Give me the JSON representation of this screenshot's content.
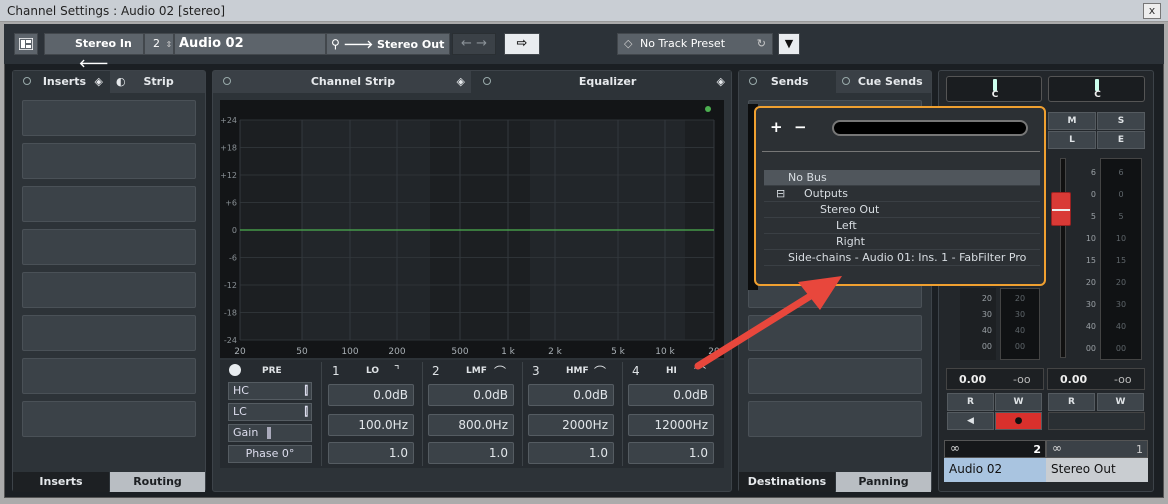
{
  "window": {
    "title": "Channel Settings : Audio 02 [stereo]",
    "close_label": "x"
  },
  "toolbar": {
    "input_route": "Stereo In",
    "channel_number": "2",
    "channel_name": "Audio 02",
    "output_route": "Stereo Out",
    "track_preset": "No Track Preset"
  },
  "left_panel": {
    "tab_inserts": "Inserts",
    "tab_strip": "Strip",
    "bottom_inserts": "Inserts",
    "bottom_routing": "Routing"
  },
  "middle_panel": {
    "tab_channel_strip": "Channel Strip",
    "tab_equalizer": "Equalizer"
  },
  "eq": {
    "y_labels": [
      "+24",
      "+18",
      "+12",
      "+6",
      "0",
      "-6",
      "-12",
      "-18",
      "-24"
    ],
    "x_labels": [
      "20",
      "50",
      "100",
      "200",
      "500",
      "1 k",
      "2 k",
      "5 k",
      "10 k",
      "20"
    ],
    "pre_label": "PRE",
    "hc_label": "HC",
    "lc_label": "LC",
    "gain_label": "Gain",
    "phase_label": "Phase 0°",
    "bands": [
      {
        "num": "1",
        "label": "LO",
        "gain": "0.0dB",
        "freq": "100.0Hz",
        "q": "1.0"
      },
      {
        "num": "2",
        "label": "LMF",
        "gain": "0.0dB",
        "freq": "800.0Hz",
        "q": "1.0"
      },
      {
        "num": "3",
        "label": "HMF",
        "gain": "0.0dB",
        "freq": "2000Hz",
        "q": "1.0"
      },
      {
        "num": "4",
        "label": "HI",
        "gain": "0.0dB",
        "freq": "12000Hz",
        "q": "1.0"
      }
    ]
  },
  "sends_panel": {
    "tab_sends": "Sends",
    "tab_cue_sends": "Cue Sends",
    "bottom_destinations": "Destinations",
    "bottom_panning": "Panning"
  },
  "popup": {
    "plus": "+",
    "minus": "−",
    "items": [
      {
        "label": "No Bus",
        "indent": 0,
        "selected": true
      },
      {
        "label": "Outputs",
        "indent": 1,
        "expander": "⊟"
      },
      {
        "label": "Stereo Out",
        "indent": 2
      },
      {
        "label": "Left",
        "indent": 3
      },
      {
        "label": "Right",
        "indent": 3
      },
      {
        "label": "Side-chains - Audio 01: Ins. 1 - FabFilter Pro",
        "indent": 0
      }
    ]
  },
  "fader": {
    "pan_left": "C",
    "pan_right": "C",
    "m_label": "M",
    "s_label": "S",
    "l_label": "L",
    "e_label": "E",
    "scale_left": [
      "6",
      "0",
      "5",
      "10",
      "15",
      "20",
      "30",
      "40",
      "00"
    ],
    "meter_left": [
      "20",
      "30",
      "40",
      "00"
    ],
    "meter_right": [
      "6",
      "0",
      "5",
      "10",
      "15",
      "20",
      "30",
      "40",
      "00"
    ],
    "vol_left": "0.00",
    "peak_left": "-oo",
    "vol_right": "0.00",
    "peak_right": "-oo",
    "r_label": "R",
    "w_label": "W",
    "chan_num_left": "2",
    "chan_num_right": "1",
    "chan_name_left": "Audio 02",
    "chan_name_right": "Stereo Out"
  },
  "colors": {
    "accent_orange": "#f0a030",
    "arrow_red": "#e8473c",
    "record_red": "#e03030",
    "eq_line": "#4caf50"
  }
}
